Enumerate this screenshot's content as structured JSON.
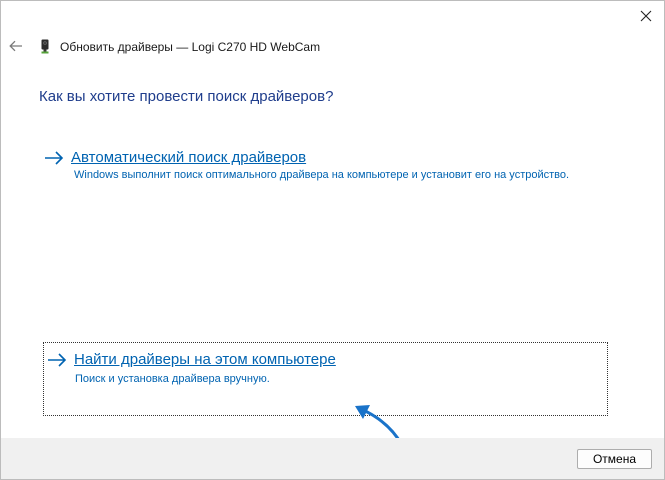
{
  "window": {
    "title": "Обновить драйверы — Logi C270 HD WebCam",
    "close_icon": "close-icon",
    "back_icon": "back-arrow-icon",
    "device_icon": "webcam-device-icon"
  },
  "main": {
    "question": "Как вы хотите провести поиск драйверов?",
    "options": [
      {
        "title": "Автоматический поиск драйверов",
        "description": "Windows выполнит поиск оптимального драйвера на компьютере и установит его на устройство.",
        "icon": "arrow-right-icon"
      },
      {
        "title": "Найти драйверы на этом компьютере",
        "description": "Поиск и установка драйвера вручную.",
        "icon": "arrow-right-icon",
        "focused": true
      }
    ]
  },
  "footer": {
    "cancel_label": "Отмена"
  },
  "colors": {
    "link": "#0063b1",
    "heading": "#1f3d8c",
    "footer_bg": "#f0f0f0",
    "annotation_arrow": "#1a73c9"
  }
}
